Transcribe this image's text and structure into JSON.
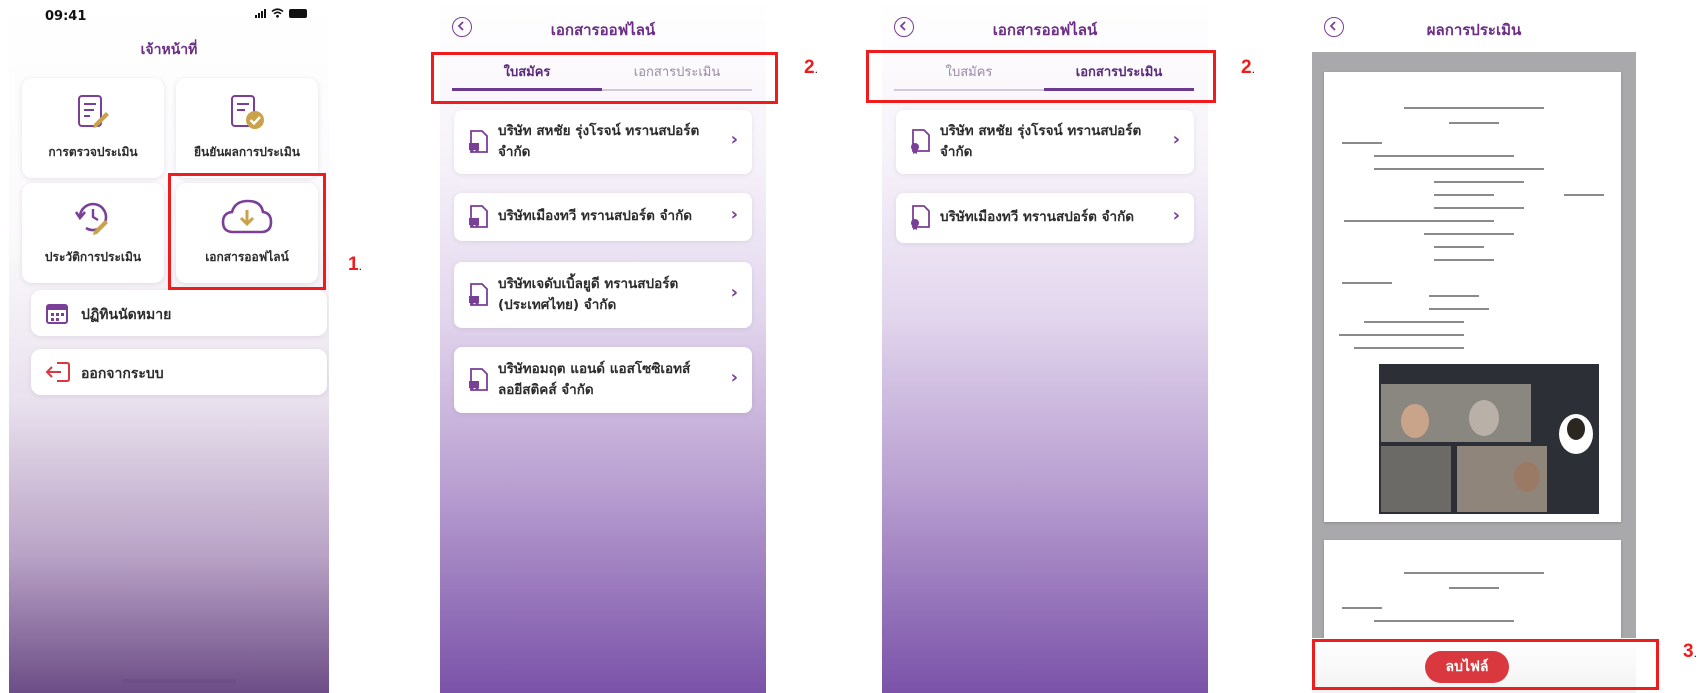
{
  "screen1": {
    "status_time": "09:41",
    "title": "เจ้าหน้าที่",
    "tiles": [
      {
        "label": "การตรวจประเมิน",
        "icon": "checklist-edit-icon"
      },
      {
        "label": "ยืนยันผลการประเมิน",
        "icon": "document-check-icon"
      },
      {
        "label": "ประวัติการประเมิน",
        "icon": "history-edit-icon"
      },
      {
        "label": "เอกสารออฟไลน์",
        "icon": "cloud-download-icon"
      }
    ],
    "rows": [
      {
        "label": "ปฏิทินนัดหมาย",
        "icon": "calendar-icon"
      },
      {
        "label": "ออกจากระบบ",
        "icon": "logout-icon"
      }
    ],
    "step_label": "1",
    "step_dot": "."
  },
  "screen2": {
    "title": "เอกสารออฟไลน์",
    "tabs": [
      "ใบสมัคร",
      "เอกสารประเมิน"
    ],
    "active_tab": 0,
    "items": [
      {
        "line1": "บริษัท สหชัย รุ่งโรจน์ ทรานสปอร์ต",
        "line2": "จำกัด"
      },
      {
        "line1": "บริษัทเมืองทวี ทรานสปอร์ต จำกัด",
        "line2": ""
      },
      {
        "line1": "บริษัทเจดับเบิ้ลยูดี ทรานสปอร์ต",
        "line2": "(ประเทศไทย) จำกัด"
      },
      {
        "line1": "บริษัทอมฤต แอนด์ แอสโซซิเอทส์",
        "line2": "ลอยีสติคส์ จำกัด"
      }
    ],
    "step_label": "2",
    "step_dot": "."
  },
  "screen3": {
    "title": "เอกสารออฟไลน์",
    "tabs": [
      "ใบสมัคร",
      "เอกสารประเมิน"
    ],
    "active_tab": 1,
    "items": [
      {
        "line1": "บริษัท สหชัย รุ่งโรจน์ ทรานสปอร์ต",
        "line2": "จำกัด"
      },
      {
        "line1": "บริษัทเมืองทวี ทรานสปอร์ต จำกัด",
        "line2": ""
      }
    ],
    "step_label": "2",
    "step_dot": "."
  },
  "screen4": {
    "title": "ผลการประเมิน",
    "delete_button": "ลบไฟล์",
    "step_label": "3",
    "step_dot": "."
  },
  "colors": {
    "brand_purple": "#6b2d85",
    "highlight_red": "#ee1c1c",
    "delete_red": "#d9383e",
    "icon_gold": "#c9a24a"
  }
}
